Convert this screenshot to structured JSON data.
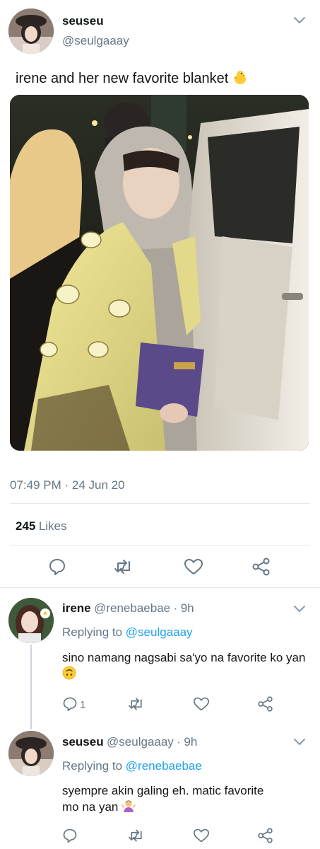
{
  "tweet": {
    "display_name": "seuseu",
    "handle": "@seulgaaay",
    "text": "irene and her new favorite blanket",
    "emoji": "chick-emoji",
    "time": "07:49 PM",
    "separator": "·",
    "date": "24 Jun 20",
    "likes_count": "245",
    "likes_label": "Likes",
    "actions": [
      "reply-icon",
      "retweet-icon",
      "like-icon",
      "share-icon"
    ]
  },
  "replies": [
    {
      "display_name": "irene",
      "handle": "@renebaebae",
      "separator": "·",
      "age": "9h",
      "replying_label": "Replying to",
      "replying_to": "@seulgaaay",
      "text": "sino namang nagsabi sa'yo na favorite ko yan",
      "emoji": "upside-down-face-emoji",
      "reply_count": "1"
    },
    {
      "display_name": "seuseu",
      "handle": "@seulgaaay",
      "separator": "·",
      "age": "9h",
      "replying_label": "Replying to",
      "replying_to": "@renebaebae",
      "text_line1": "syempre akin galing eh. matic favorite",
      "text_line2": "mo na yan",
      "emoji": "person-shrugging-emoji",
      "reply_count": ""
    }
  ],
  "colors": {
    "link": "#1da1f2",
    "secondary_text": "#657786",
    "divider": "#e1e8ed",
    "thread_line": "#ccd6dd"
  }
}
